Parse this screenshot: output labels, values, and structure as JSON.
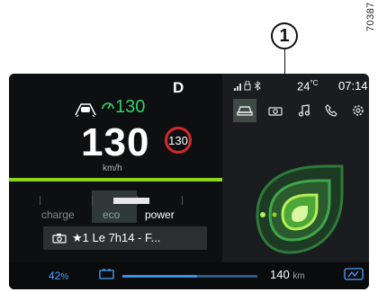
{
  "figure": {
    "reference_number": "70387",
    "callout_label": "1"
  },
  "left_panel": {
    "gear": "D",
    "acc_set_speed": "130",
    "current_speed": "130",
    "speed_limit_sign": "130",
    "speed_unit": "km/h",
    "power_meter": {
      "labels": [
        "charge",
        "eco",
        "power"
      ],
      "level_fraction": 0.6
    },
    "navigation": {
      "icon": "camera-icon",
      "destination_text": "★1 Le 7h14 - F..."
    }
  },
  "right_panel": {
    "status_icons": [
      "signal-icon",
      "lock-icon",
      "bluetooth-icon"
    ],
    "temperature": "24",
    "temperature_unit": "°C",
    "time": "07:14",
    "tabs": [
      {
        "icon": "car-icon",
        "active": true
      },
      {
        "icon": "camera-icon",
        "active": false
      },
      {
        "icon": "music-icon",
        "active": false
      },
      {
        "icon": "phone-icon",
        "active": false
      },
      {
        "icon": "settings-icon",
        "active": false
      }
    ],
    "eco_graphic_icon": "eco-leaf-icon"
  },
  "bottom_bar": {
    "battery_percent": "42",
    "battery_unit": "%",
    "range_value": "140",
    "range_unit": "km",
    "range_fraction": 0.55,
    "regen_icon": "regen-braking-icon"
  },
  "colors": {
    "accent_green": "#8ed61a",
    "speed_green": "#2fd16b",
    "limit_red": "#d62828",
    "battery_blue": "#3a8fe0"
  }
}
